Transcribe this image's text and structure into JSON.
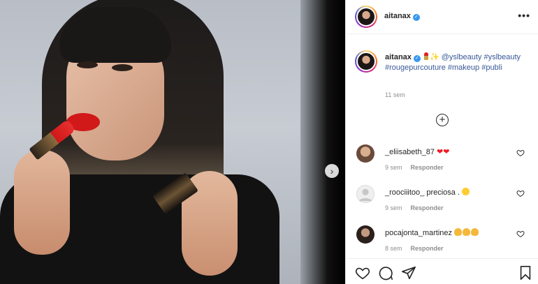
{
  "post": {
    "author": "aitanax",
    "verified_mark": "✓",
    "more_label": "•••",
    "caption": {
      "emoji_lipstick": "lipstick-icon",
      "emoji_sparkles": "sparkles-icon",
      "mention": "@yslbeauty",
      "hashtags": "#yslbeauty #rougepurcouture #makeup #publi"
    },
    "time_ago": "11 sem",
    "load_more_label": "+"
  },
  "comments": [
    {
      "username": "_eliisabeth_87",
      "text": "❤❤",
      "time": "9 sem",
      "reply": "Responder"
    },
    {
      "username": "_rooсiiitoo_",
      "text": "preciosa .",
      "time": "9 sem",
      "reply": "Responder"
    },
    {
      "username": "pocajonta_martinez",
      "text": "",
      "time": "8 sem",
      "reply": "Responder"
    }
  ],
  "nav": {
    "next_label": "›"
  },
  "colors": {
    "link": "#385898",
    "meta": "#8e8e8e",
    "border": "#efefef",
    "verified": "#3897f0"
  }
}
